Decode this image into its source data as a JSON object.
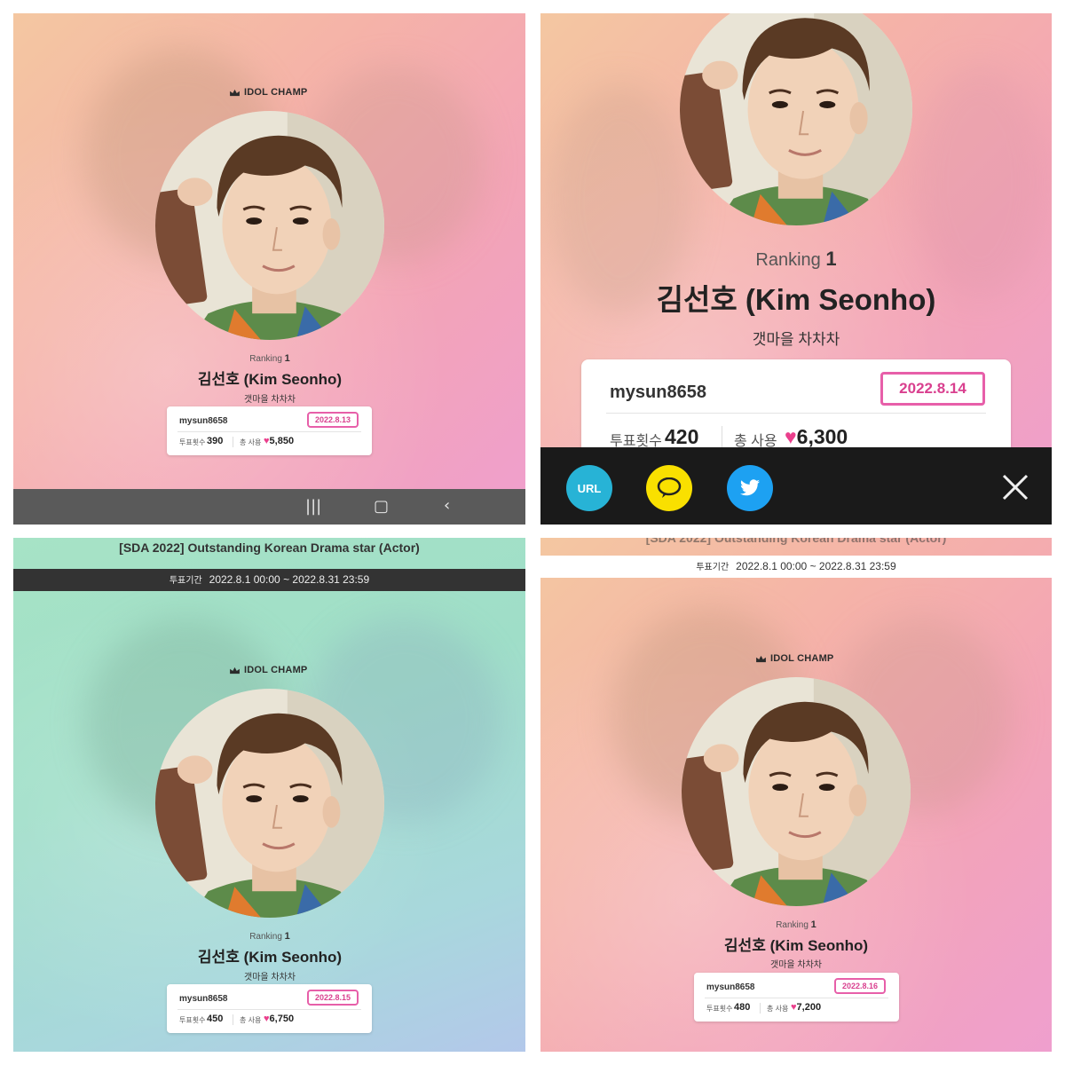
{
  "logo_text": "IDOL CHAMP",
  "ranking_label": "Ranking",
  "ranking_value": "1",
  "artist_name": "김선호 (Kim Seonho)",
  "artist_show": "갯마을 차차차",
  "username": "mysun8658",
  "votes_label": "투표횟수",
  "total_used_label": "총 사용",
  "event_title": "[SDA 2022] Outstanding Korean Drama star (Actor)",
  "period_label": "투표기간",
  "period_value": "2022.8.1 00:00 ~ 2022.8.31 23:59",
  "panels": [
    {
      "date": "2022.8.13",
      "votes": "390",
      "total": "5,850"
    },
    {
      "date": "2022.8.14",
      "votes": "420",
      "total": "6,300"
    },
    {
      "date": "2022.8.15",
      "votes": "450",
      "total": "6,750"
    },
    {
      "date": "2022.8.16",
      "votes": "480",
      "total": "7,200"
    }
  ],
  "share": {
    "url_label": "URL"
  },
  "icons": {
    "crown": "crown-icon",
    "heart": "heart-icon",
    "nav_recent": "recent-apps-icon",
    "nav_home": "home-icon",
    "nav_back": "back-icon",
    "kakao": "kakaotalk-icon",
    "twitter": "twitter-icon",
    "close": "close-icon"
  },
  "colors": {
    "accent_pink": "#e75fa9",
    "heart": "#ea3f8c",
    "url_button": "#27b3d6",
    "kakao_button": "#f9e000",
    "twitter_button": "#1da1f2"
  }
}
